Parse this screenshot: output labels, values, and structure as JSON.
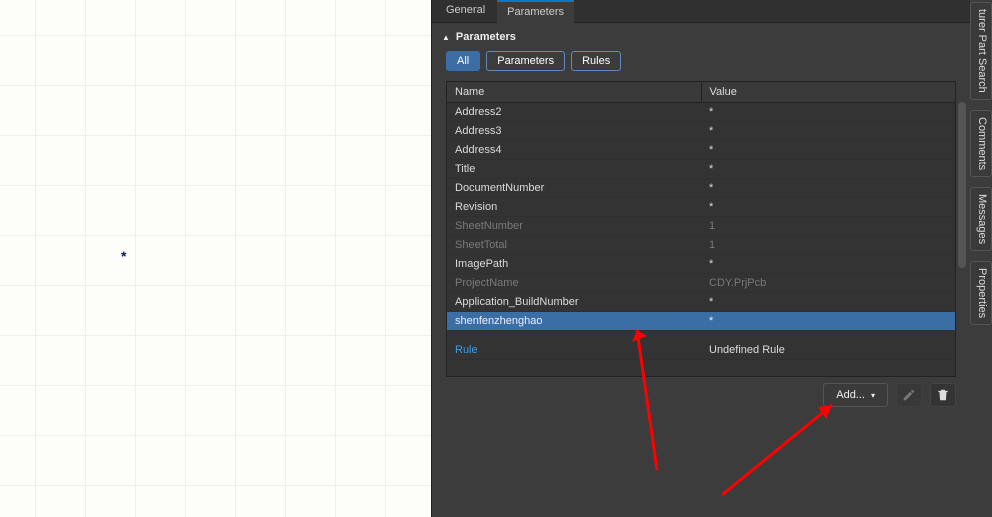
{
  "panel": {
    "tabs": {
      "general": "General",
      "parameters": "Parameters",
      "active": "parameters"
    },
    "section_title": "Parameters",
    "filters": {
      "all": "All",
      "parameters": "Parameters",
      "rules": "Rules",
      "active": "all"
    },
    "columns": {
      "name": "Name",
      "value": "Value"
    },
    "rows": [
      {
        "name": "Address2",
        "value": "*",
        "readonly": false
      },
      {
        "name": "Address3",
        "value": "*",
        "readonly": false
      },
      {
        "name": "Address4",
        "value": "*",
        "readonly": false
      },
      {
        "name": "Title",
        "value": "*",
        "readonly": false
      },
      {
        "name": "DocumentNumber",
        "value": "*",
        "readonly": false
      },
      {
        "name": "Revision",
        "value": "*",
        "readonly": false
      },
      {
        "name": "SheetNumber",
        "value": "1",
        "readonly": true
      },
      {
        "name": "SheetTotal",
        "value": "1",
        "readonly": true
      },
      {
        "name": "ImagePath",
        "value": "*",
        "readonly": false
      },
      {
        "name": "ProjectName",
        "value": "CDY.PrjPcb",
        "readonly": true
      },
      {
        "name": "Application_BuildNumber",
        "value": "*",
        "readonly": false
      },
      {
        "name": "shenfenzhenghao",
        "value": "*",
        "readonly": false,
        "selected": true
      }
    ],
    "rule_row": {
      "name": "Rule",
      "value": "Undefined Rule"
    },
    "add_label": "Add..."
  },
  "side_tabs": {
    "search": "turer Part Search",
    "comments": "Comments",
    "messages": "Messages",
    "properties": "Properties"
  },
  "canvas": {
    "star": "*"
  }
}
